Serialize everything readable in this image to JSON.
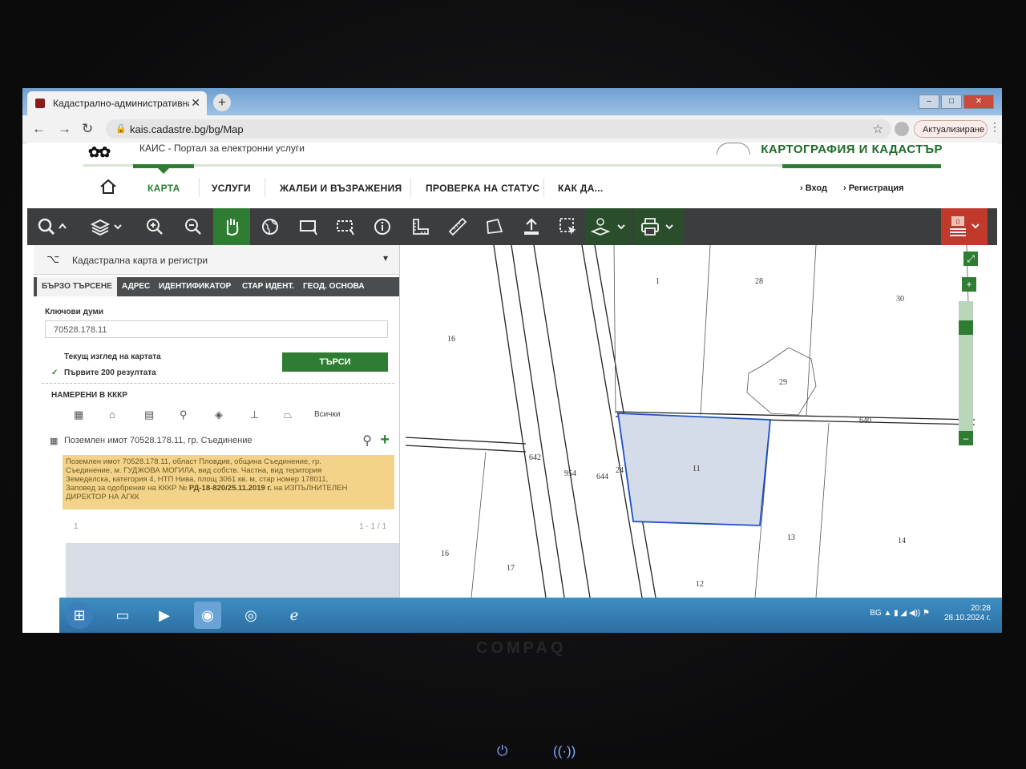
{
  "browser": {
    "tab_title": "Кадастрално-административна",
    "url": "kais.cadastre.bg/bg/Map",
    "update_label": "Актуализиране"
  },
  "site": {
    "portal_title": "КАИС - Портал за електронни услуги",
    "agency_name": "КАРТОГРАФИЯ И КАДАСТЪР",
    "menu": {
      "map": "КАРТА",
      "services": "УСЛУГИ",
      "complaints": "ЖАЛБИ И ВЪЗРАЖЕНИЯ",
      "status": "ПРОВЕРКА НА СТАТУС",
      "howto": "КАК ДА..."
    },
    "login": "Вход",
    "register": "Регистрация"
  },
  "toolbar": {
    "badge": "0"
  },
  "panel": {
    "header": "Кадастрална карта и регистри",
    "tabs": [
      "БЪРЗО ТЪРСЕНЕ",
      "АДРЕС",
      "ИДЕНТИФИКАТОР",
      "СТАР ИДЕНТ.",
      "ГЕОД. ОСНОВА"
    ],
    "keywords_label": "Ключови думи",
    "keywords_value": "70528.178.11",
    "opt_current_view": "Текущ изглед на картата",
    "opt_first_200": "Първите 200 резултата",
    "search_button": "ТЪРСИ",
    "found_label": "НАМЕРЕНИ В КККР",
    "filter_all": "Всички",
    "result_title": "Поземлен имот 70528.178.11, гр. Съединение",
    "result_line1": "Поземлен имот 70528.178.11, област Пловдив, община Съединение, гр.",
    "result_line2": "Съединение, м. ГУДЖОВА МОГИЛА, вид собств. Частна, вид територия",
    "result_line3": "Земеделска, категория 4, НТП Нива, площ 3061 кв. м, стар номер 178011,",
    "result_line4_pre": "Заповед за одобрение на КККР №",
    "result_line4_bold": "РД-18-820/25.11.2019 г.",
    "result_line4_post": "на ИЗПЪЛНИТЕЛЕН",
    "result_line5": "ДИРЕКТОР НА АГКК",
    "page_number": "1",
    "page_count": "1 - 1 / 1"
  },
  "map": {
    "labels": [
      "1",
      "28",
      "30",
      "16",
      "29",
      "640",
      "642",
      "954",
      "644",
      "24",
      "11",
      "13",
      "14",
      "16",
      "17",
      "12"
    ]
  },
  "taskbar": {
    "lang": "BG",
    "time": "20:28",
    "date": "28.10.2024 г."
  },
  "device": {
    "brand": "COMPAQ"
  },
  "colors": {
    "accent_green": "#2e7d32",
    "toolbar_dark": "#3b3d3f",
    "highlight_parcel": "#1f4fbf",
    "info_yellow": "#f3d38a"
  }
}
